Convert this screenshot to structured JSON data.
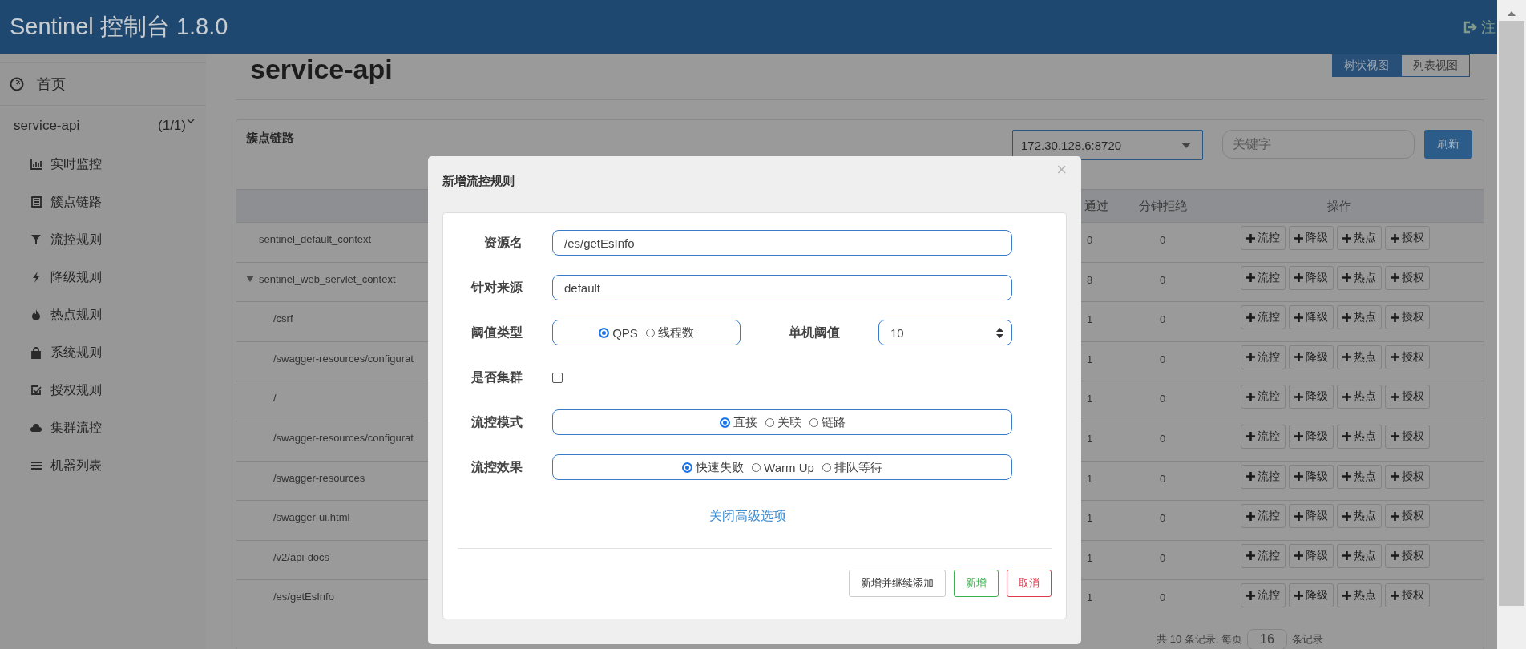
{
  "header": {
    "title": "Sentinel 控制台 1.8.0",
    "logout": "注"
  },
  "sidebar": {
    "home": "首页",
    "app": {
      "name": "service-api",
      "count": "(1/1)",
      "expanded": true
    },
    "items": [
      {
        "label": "实时监控"
      },
      {
        "label": "簇点链路"
      },
      {
        "label": "流控规则"
      },
      {
        "label": "降级规则"
      },
      {
        "label": "热点规则"
      },
      {
        "label": "系统规则"
      },
      {
        "label": "授权规则"
      },
      {
        "label": "集群流控"
      },
      {
        "label": "机器列表"
      }
    ]
  },
  "page": {
    "title": "service-api",
    "views": [
      {
        "label": "树状视图",
        "selected": true
      },
      {
        "label": "列表视图",
        "selected": false
      }
    ]
  },
  "panel": {
    "title": "簇点链路",
    "machine": "172.30.128.6:8720",
    "search": {
      "placeholder": "关键字"
    },
    "refresh": "刷新",
    "table": {
      "columns": [
        "通过",
        "分钟拒绝",
        "操作"
      ],
      "rows": [
        {
          "resource": "sentinel_default_context",
          "pass": "0",
          "block": "0",
          "actions": [
            "流控",
            "降级",
            "热点",
            "授权"
          ]
        },
        {
          "resource": "sentinel_web_servlet_context",
          "pass": "8",
          "block": "0",
          "actions": [
            "流控",
            "降级",
            "热点",
            "授权"
          ],
          "expanded": true,
          "children": [
            {
              "resource": "/csrf",
              "pass": "1",
              "block": "0",
              "actions": [
                "流控",
                "降级",
                "热点",
                "授权"
              ]
            },
            {
              "resource": "/swagger-resources/configurat",
              "pass": "1",
              "block": "0",
              "actions": [
                "流控",
                "降级",
                "热点",
                "授权"
              ]
            },
            {
              "resource": "/",
              "pass": "1",
              "block": "0",
              "actions": [
                "流控",
                "降级",
                "热点",
                "授权"
              ]
            },
            {
              "resource": "/swagger-resources/configurat",
              "pass": "1",
              "block": "0",
              "actions": [
                "流控",
                "降级",
                "热点",
                "授权"
              ]
            },
            {
              "resource": "/swagger-resources",
              "pass": "1",
              "block": "0",
              "actions": [
                "流控",
                "降级",
                "热点",
                "授权"
              ]
            },
            {
              "resource": "/swagger-ui.html",
              "pass": "1",
              "block": "0",
              "actions": [
                "流控",
                "降级",
                "热点",
                "授权"
              ]
            },
            {
              "resource": "/v2/api-docs",
              "pass": "1",
              "block": "0",
              "actions": [
                "流控",
                "降级",
                "热点",
                "授权"
              ]
            },
            {
              "resource": "/es/getEsInfo",
              "pass": "1",
              "block": "0",
              "actions": [
                "流控",
                "降级",
                "热点",
                "授权"
              ]
            }
          ]
        }
      ]
    },
    "footer": {
      "total": "共 10 条记录, 每页",
      "page_size": "16",
      "suffix": "条记录"
    }
  },
  "dialog": {
    "title": "新增流控规则",
    "close": "×",
    "form": [
      {
        "kind": "text",
        "label": "资源名",
        "value": "/es/getEsInfo"
      },
      {
        "kind": "text",
        "label": "针对来源",
        "value": "default"
      },
      {
        "kind": "radio",
        "label": "阈值类型",
        "options": [
          {
            "label": "QPS",
            "selected": true
          },
          {
            "label": "线程数",
            "selected": false
          }
        ],
        "extra": {
          "label": "单机阈值",
          "value": "10"
        }
      },
      {
        "kind": "checkbox",
        "label": "是否集群",
        "checked": false
      },
      {
        "kind": "radio",
        "label": "流控模式",
        "options": [
          {
            "label": "直接",
            "selected": true
          },
          {
            "label": "关联",
            "selected": false
          },
          {
            "label": "链路",
            "selected": false
          }
        ]
      },
      {
        "kind": "radio",
        "label": "流控效果",
        "options": [
          {
            "label": "快速失败",
            "selected": true
          },
          {
            "label": "Warm Up",
            "selected": false
          },
          {
            "label": "排队等待",
            "selected": false
          }
        ]
      }
    ],
    "advanced_toggle": "关闭高级选项",
    "buttons": [
      {
        "label": "新增并继续添加",
        "kind": "default"
      },
      {
        "label": "新增",
        "kind": "success"
      },
      {
        "label": "取消",
        "kind": "danger"
      }
    ]
  }
}
